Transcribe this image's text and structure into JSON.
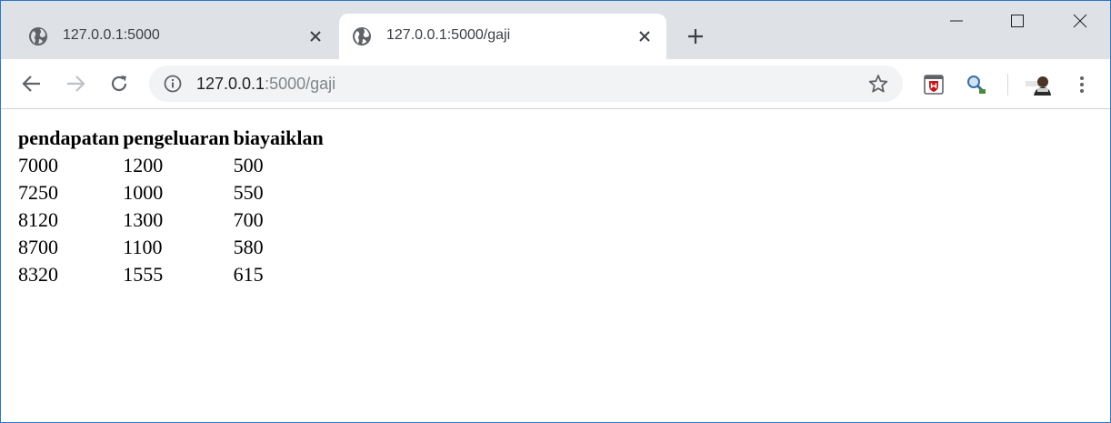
{
  "browser": {
    "tabs": [
      {
        "title": "127.0.0.1:5000",
        "active": false
      },
      {
        "title": "127.0.0.1:5000/gaji",
        "active": true
      }
    ],
    "address": {
      "host": "127.0.0.1",
      "path": ":5000/gaji"
    }
  },
  "table": {
    "headers": [
      "pendapatan",
      "pengeluaran",
      "biayaiklan"
    ],
    "rows": [
      [
        "7000",
        "1200",
        "500"
      ],
      [
        "7250",
        "1000",
        "550"
      ],
      [
        "8120",
        "1300",
        "700"
      ],
      [
        "8700",
        "1100",
        "580"
      ],
      [
        "8320",
        "1555",
        "615"
      ]
    ]
  },
  "colors": {
    "tabstrip": "#dee1e6",
    "omnibox": "#f1f3f4",
    "window_border": "#2b78c8",
    "extension_accent": "#c01818"
  },
  "icons": [
    "globe-icon",
    "close-icon",
    "plus-icon",
    "minimize-icon",
    "maximize-icon",
    "window-close-icon",
    "back-arrow-icon",
    "forward-arrow-icon",
    "reload-icon",
    "info-icon",
    "star-icon",
    "shield-extension-icon",
    "search-extension-icon",
    "profile-avatar-icon",
    "kebab-menu-icon"
  ]
}
